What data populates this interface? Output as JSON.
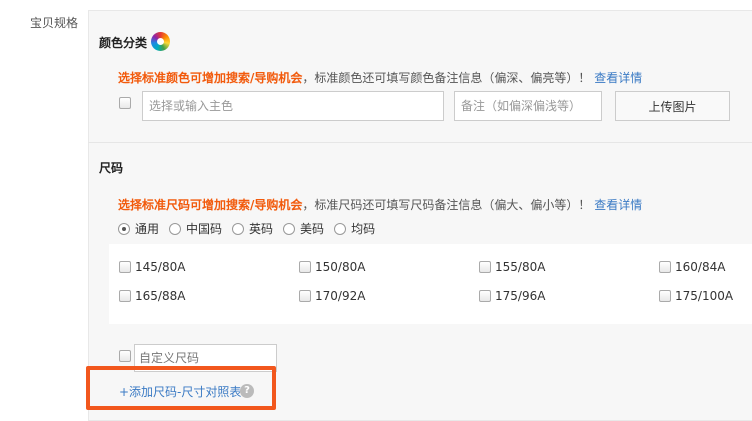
{
  "section_label": "宝贝规格",
  "color": {
    "title": "颜色分类",
    "hint_orange": "选择标准颜色可增加搜索/导购机会",
    "hint_text": "，标准颜色还可填写颜色备注信息（偏深、偏亮等）！",
    "hint_link": "查看详情",
    "main_placeholder": "选择或输入主色",
    "note_placeholder": "备注（如偏深偏浅等）",
    "upload_label": "上传图片"
  },
  "size": {
    "title": "尺码",
    "hint_orange": "选择标准尺码可增加搜索/导购机会",
    "hint_text": "，标准尺码还可填写尺码备注信息（偏大、偏小等）！",
    "hint_link": "查看详情",
    "radio_options": [
      "通用",
      "中国码",
      "英码",
      "美码",
      "均码"
    ],
    "selected_radio": "通用",
    "sizes": [
      "145/80A",
      "150/80A",
      "155/80A",
      "160/84A",
      "165/88A",
      "170/92A",
      "175/96A",
      "175/100A"
    ],
    "custom_placeholder": "自定义尺码",
    "add_chart_link": "+添加尺码-尺寸对照表",
    "help_icon_glyph": "?"
  },
  "colors": {
    "highlight": "#f2571d",
    "link": "#3a7ac4",
    "orange_text": "#f25a0c"
  }
}
